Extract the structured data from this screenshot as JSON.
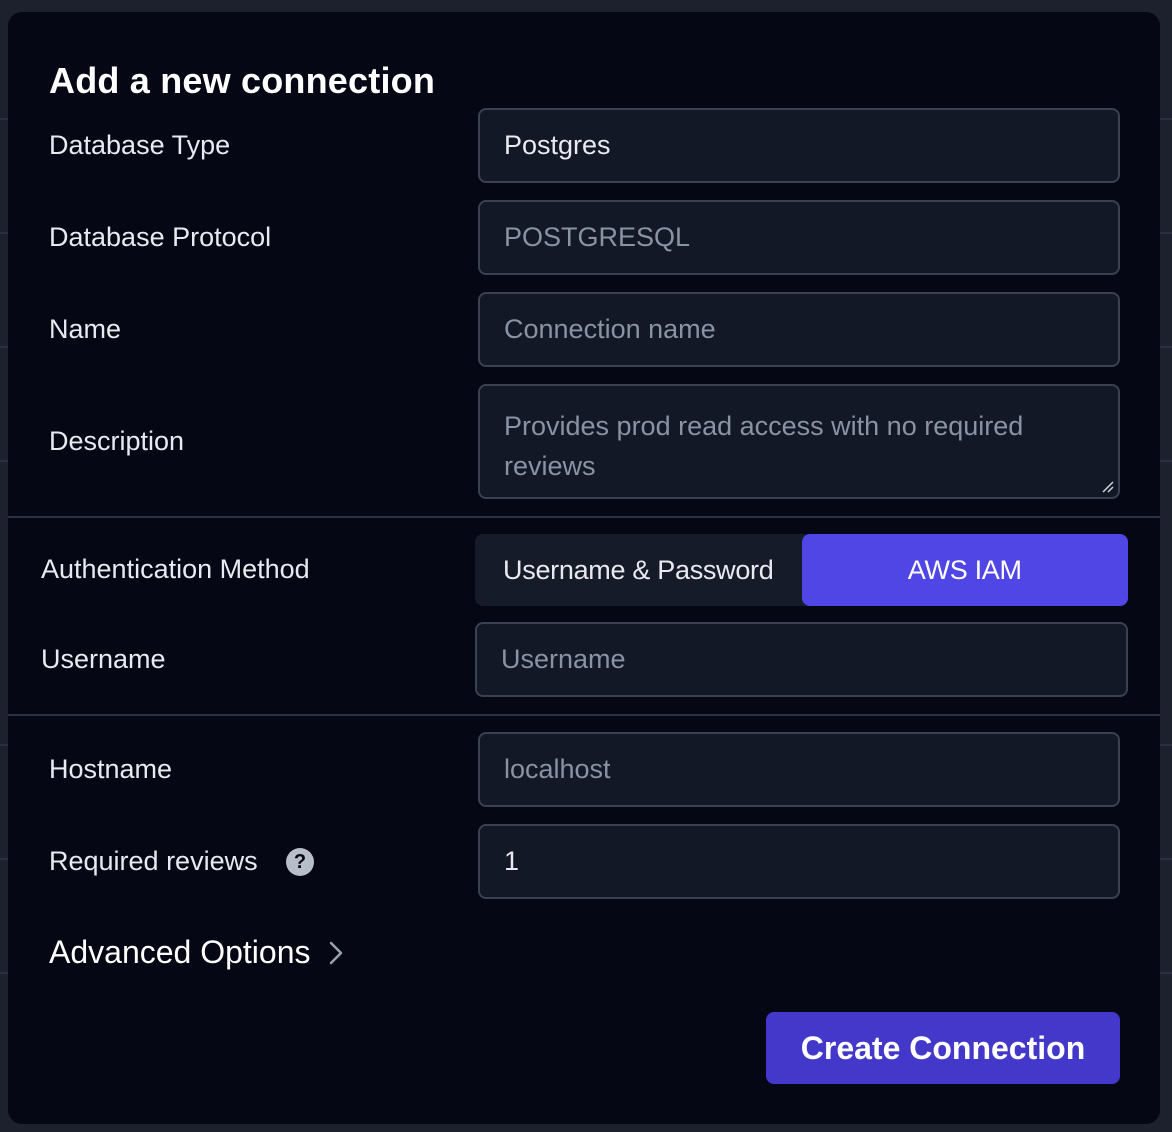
{
  "modal": {
    "title": "Add a new connection",
    "fields": {
      "database_type": {
        "label": "Database Type",
        "value": "Postgres"
      },
      "database_protocol": {
        "label": "Database Protocol",
        "value": "POSTGRESQL"
      },
      "name": {
        "label": "Name",
        "placeholder": "Connection name"
      },
      "description": {
        "label": "Description",
        "placeholder": "Provides prod read access with no required reviews"
      },
      "auth_method": {
        "label": "Authentication Method",
        "options": [
          "Username & Password",
          "AWS IAM"
        ],
        "selected": "AWS IAM"
      },
      "username": {
        "label": "Username",
        "placeholder": "Username"
      },
      "hostname": {
        "label": "Hostname",
        "placeholder": "localhost"
      },
      "required_reviews": {
        "label": "Required reviews",
        "value": "1",
        "help_icon": "question-circle-icon"
      }
    },
    "advanced_options_label": "Advanced Options",
    "create_button_label": "Create Connection"
  },
  "colors": {
    "accent": "#4f46e5",
    "button": "#4338ca",
    "modal_bg": "#050814",
    "field_bg": "#121826"
  }
}
